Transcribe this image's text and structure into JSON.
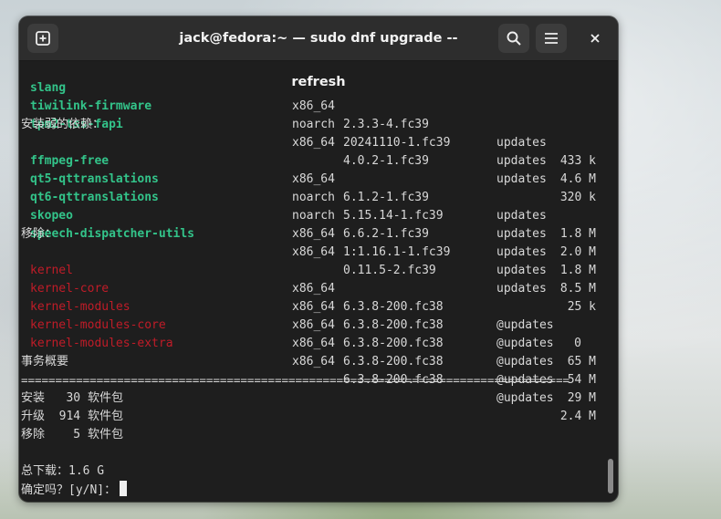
{
  "window": {
    "title": "jack@fedora:~ — sudo dnf upgrade --refresh"
  },
  "packages_top": [
    {
      "name": "slang",
      "arch": "x86_64",
      "version": "2.3.3-4.fc39",
      "repo": "updates",
      "size": "433 k"
    },
    {
      "name": "tiwilink-firmware",
      "arch": "noarch",
      "version": "20241110-1.fc39",
      "repo": "updates",
      "size": "4.6 M"
    },
    {
      "name": "tpm2-tss-fapi",
      "arch": "x86_64",
      "version": "4.0.2-1.fc39",
      "repo": "updates",
      "size": "320 k"
    }
  ],
  "weak_deps_header": "安装弱的依赖：",
  "weak_deps": [
    {
      "name": "ffmpeg-free",
      "arch": "x86_64",
      "version": "6.1.2-1.fc39",
      "repo": "updates",
      "size": "1.8 M"
    },
    {
      "name": "qt5-qttranslations",
      "arch": "noarch",
      "version": "5.15.14-1.fc39",
      "repo": "updates",
      "size": "2.0 M"
    },
    {
      "name": "qt6-qttranslations",
      "arch": "noarch",
      "version": "6.6.2-1.fc39",
      "repo": "updates",
      "size": "1.8 M"
    },
    {
      "name": "skopeo",
      "arch": "x86_64",
      "version": "1:1.16.1-1.fc39",
      "repo": "updates",
      "size": "8.5 M"
    },
    {
      "name": "speech-dispatcher-utils",
      "arch": "x86_64",
      "version": "0.11.5-2.fc39",
      "repo": "updates",
      "size": "25 k"
    }
  ],
  "remove_header": "移除：",
  "removals": [
    {
      "name": "kernel",
      "arch": "x86_64",
      "version": "6.3.8-200.fc38",
      "repo": "@updates",
      "size": "0"
    },
    {
      "name": "kernel-core",
      "arch": "x86_64",
      "version": "6.3.8-200.fc38",
      "repo": "@updates",
      "size": "65 M"
    },
    {
      "name": "kernel-modules",
      "arch": "x86_64",
      "version": "6.3.8-200.fc38",
      "repo": "@updates",
      "size": "54 M"
    },
    {
      "name": "kernel-modules-core",
      "arch": "x86_64",
      "version": "6.3.8-200.fc38",
      "repo": "@updates",
      "size": "29 M"
    },
    {
      "name": "kernel-modules-extra",
      "arch": "x86_64",
      "version": "6.3.8-200.fc38",
      "repo": "@updates",
      "size": "2.4 M"
    }
  ],
  "summary": {
    "header": "事务概要",
    "separator": "================================================================================",
    "install": "安装   30 软件包",
    "upgrade": "升级  914 软件包",
    "remove": "移除    5 软件包",
    "download": "总下载：1.6 G",
    "prompt": "确定吗？[y/N]："
  },
  "icons": {
    "new_tab": "new-tab-icon",
    "search": "search-icon",
    "menu": "hamburger-menu-icon",
    "close": "close-icon"
  },
  "colors": {
    "terminal_bg": "#1e1e1e",
    "installed_pkg": "#33c48a",
    "removed_pkg": "#c01c28"
  }
}
